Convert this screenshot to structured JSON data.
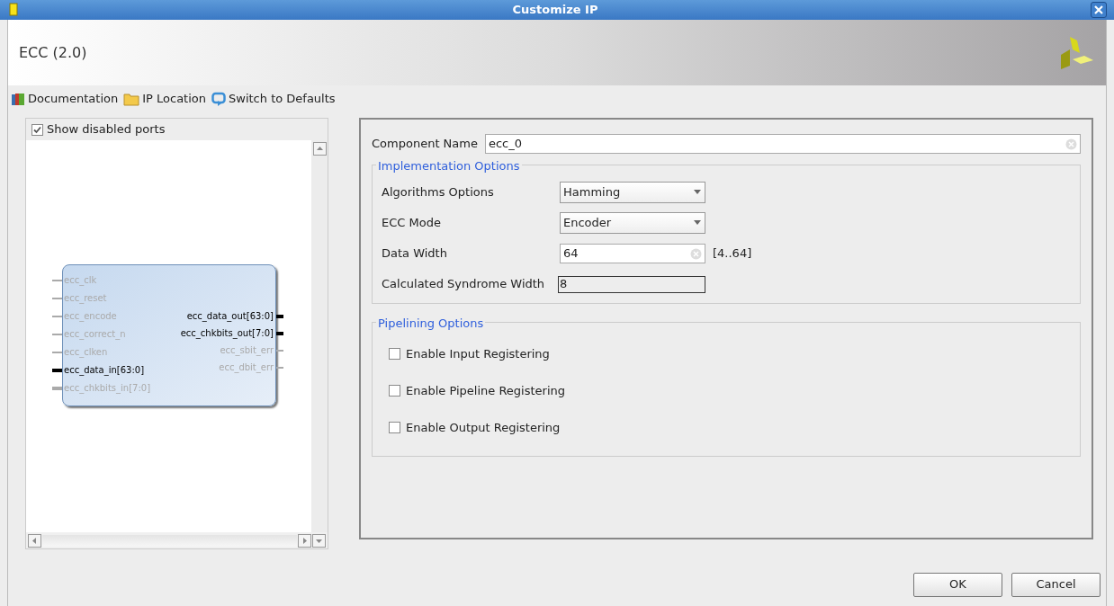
{
  "window": {
    "title": "Customize IP"
  },
  "header": {
    "title": "ECC (2.0)"
  },
  "toolbar": [
    {
      "kind": "book",
      "label": "Documentation"
    },
    {
      "kind": "folder",
      "label": "IP Location"
    },
    {
      "kind": "reset",
      "label": "Switch to Defaults"
    }
  ],
  "symbol_panel": {
    "show_disabled_ports": {
      "label": "Show disabled ports",
      "checked": true
    },
    "inputs": [
      {
        "name": "ecc_clk",
        "enabled": false,
        "bus": false
      },
      {
        "name": "ecc_reset",
        "enabled": false,
        "bus": false
      },
      {
        "name": "ecc_encode",
        "enabled": false,
        "bus": false
      },
      {
        "name": "ecc_correct_n",
        "enabled": false,
        "bus": false
      },
      {
        "name": "ecc_clken",
        "enabled": false,
        "bus": false
      },
      {
        "name": "ecc_data_in[63:0]",
        "enabled": true,
        "bus": true
      },
      {
        "name": "ecc_chkbits_in[7:0]",
        "enabled": false,
        "bus": true
      }
    ],
    "outputs": [
      {
        "name": "ecc_data_out[63:0]",
        "enabled": true,
        "bus": true
      },
      {
        "name": "ecc_chkbits_out[7:0]",
        "enabled": true,
        "bus": true
      },
      {
        "name": "ecc_sbit_err",
        "enabled": false,
        "bus": false
      },
      {
        "name": "ecc_dbit_err",
        "enabled": false,
        "bus": false
      }
    ]
  },
  "component_name": {
    "label": "Component Name",
    "value": "ecc_0"
  },
  "implementation_options": {
    "title": "Implementation Options",
    "fields": [
      {
        "kind": "dropdown",
        "label": "Algorithms Options",
        "value": "Hamming"
      },
      {
        "kind": "dropdown",
        "label": "ECC Mode",
        "value": "Encoder"
      },
      {
        "kind": "input",
        "label": "Data Width",
        "value": "64",
        "range": "[4..64]"
      },
      {
        "kind": "readonly",
        "label": "Calculated Syndrome Width",
        "value": "8"
      }
    ]
  },
  "pipelining_options": {
    "title": "Pipelining Options",
    "options": [
      {
        "label": "Enable Input Registering",
        "checked": false
      },
      {
        "label": "Enable Pipeline Registering",
        "checked": false
      },
      {
        "label": "Enable Output Registering",
        "checked": false
      }
    ]
  },
  "buttons": [
    "OK",
    "Cancel"
  ]
}
